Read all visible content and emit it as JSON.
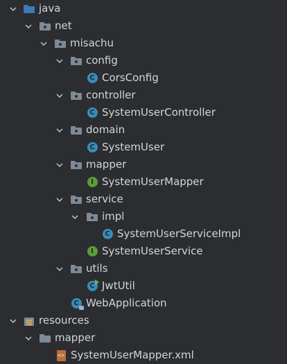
{
  "tree": {
    "rows": [
      {
        "label": "java",
        "icon": "source-folder-icon",
        "expanded": true
      },
      {
        "label": "net",
        "icon": "package-folder-icon",
        "expanded": true
      },
      {
        "label": "misachu",
        "icon": "package-folder-icon",
        "expanded": true
      },
      {
        "label": "config",
        "icon": "package-folder-icon",
        "expanded": true
      },
      {
        "label": "CorsConfig",
        "icon": "class-icon"
      },
      {
        "label": "controller",
        "icon": "package-folder-icon",
        "expanded": true
      },
      {
        "label": "SystemUserController",
        "icon": "class-icon"
      },
      {
        "label": "domain",
        "icon": "package-folder-icon",
        "expanded": true
      },
      {
        "label": "SystemUser",
        "icon": "class-icon"
      },
      {
        "label": "mapper",
        "icon": "package-folder-icon",
        "expanded": true
      },
      {
        "label": "SystemUserMapper",
        "icon": "interface-icon"
      },
      {
        "label": "service",
        "icon": "package-folder-icon",
        "expanded": true
      },
      {
        "label": "impl",
        "icon": "package-folder-icon",
        "expanded": true
      },
      {
        "label": "SystemUserServiceImpl",
        "icon": "class-icon"
      },
      {
        "label": "SystemUserService",
        "icon": "interface-icon"
      },
      {
        "label": "utils",
        "icon": "package-folder-icon",
        "expanded": true
      },
      {
        "label": "JwtUtil",
        "icon": "class-icon"
      },
      {
        "label": "WebApplication",
        "icon": "spring-boot-class-icon"
      },
      {
        "label": "resources",
        "icon": "resources-folder-icon",
        "expanded": true
      },
      {
        "label": "mapper",
        "icon": "folder-icon",
        "expanded": true
      },
      {
        "label": "SystemUserMapper.xml",
        "icon": "xml-file-icon"
      }
    ]
  },
  "colors": {
    "background": "#2b2d30",
    "text": "#d3d6d9",
    "folder": "#7d8a96",
    "source_folder": "#3d7ab8",
    "class": "#3b8bb8",
    "interface": "#5e9a3e",
    "xml": "#c06d3c"
  }
}
